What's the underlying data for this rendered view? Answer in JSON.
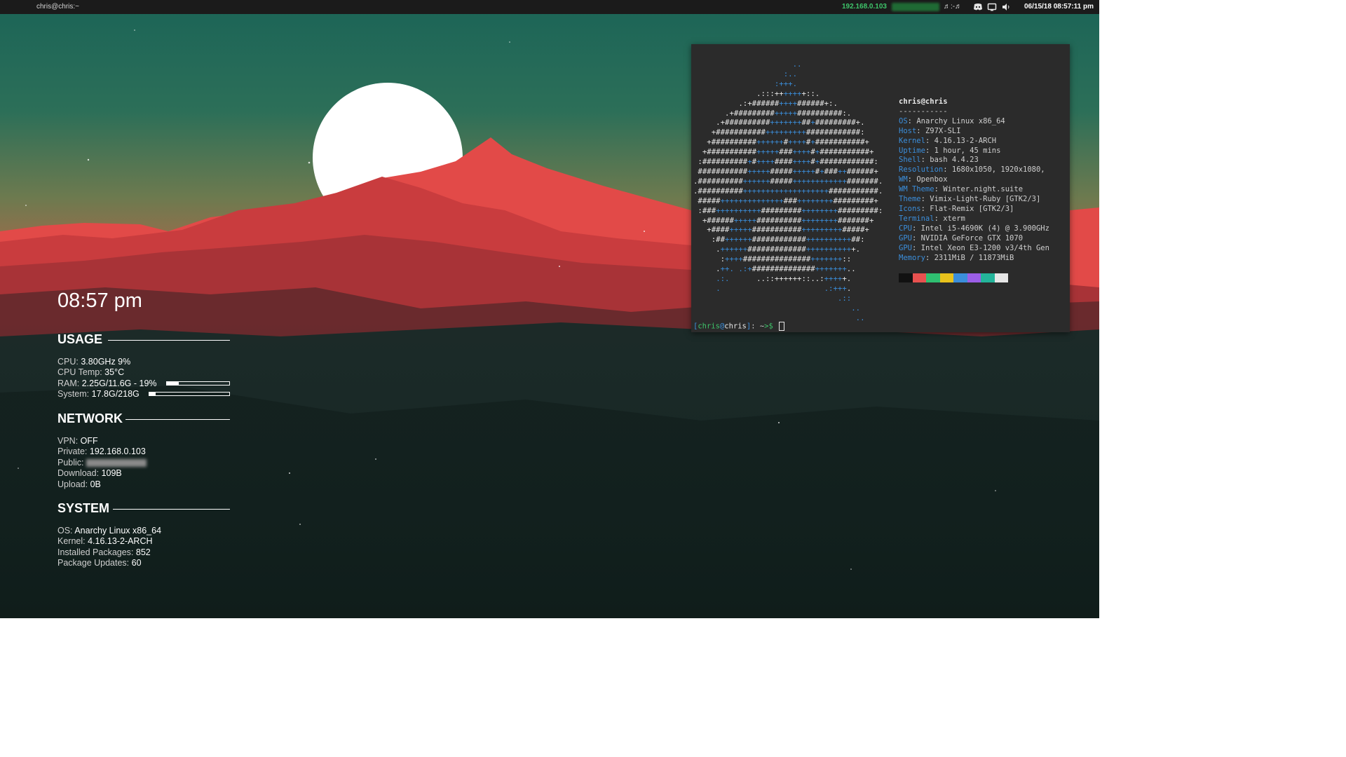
{
  "topbar": {
    "window_title": "chris@chris:~",
    "ip": "192.168.0.103",
    "music": "♬:-♬",
    "tray_icons": [
      "discord-icon",
      "display-icon",
      "volume-icon"
    ],
    "clock": "06/15/18 08:57:11 pm"
  },
  "conky": {
    "time": "08:57 pm",
    "usage": {
      "heading": "USAGE",
      "cpu_label": "CPU:",
      "cpu_value": "3.80GHz 9%",
      "temp_label": "CPU Temp:",
      "temp_value": "35°C",
      "ram_label": "RAM:",
      "ram_value": "2.25G/11.6G - 19%",
      "ram_fraction": 0.19,
      "system_label": "System:",
      "system_value": "17.8G/218G",
      "system_fraction": 0.08
    },
    "network": {
      "heading": "NETWORK",
      "vpn_label": "VPN:",
      "vpn_value": "OFF",
      "private_label": "Private:",
      "private_value": "192.168.0.103",
      "public_label": "Public:",
      "download_label": "Download:",
      "download_value": "109B",
      "upload_label": "Upload:",
      "upload_value": "0B"
    },
    "system": {
      "heading": "SYSTEM",
      "os_label": "OS:",
      "os_value": "Anarchy Linux x86_64",
      "kernel_label": "Kernel:",
      "kernel_value": "4.16.13-2-ARCH",
      "packages_label": "Installed Packages:",
      "packages_value": "852",
      "updates_label": "Package Updates:",
      "updates_value": "60"
    }
  },
  "terminal": {
    "user_host": "chris@chris",
    "separator": "-----------",
    "info": [
      {
        "key": "OS",
        "value": "Anarchy Linux x86_64"
      },
      {
        "key": "Host",
        "value": "Z97X-SLI"
      },
      {
        "key": "Kernel",
        "value": "4.16.13-2-ARCH"
      },
      {
        "key": "Uptime",
        "value": "1 hour, 45 mins"
      },
      {
        "key": "Shell",
        "value": "bash 4.4.23"
      },
      {
        "key": "Resolution",
        "value": "1680x1050, 1920x1080,"
      },
      {
        "key": "WM",
        "value": "Openbox"
      },
      {
        "key": "WM Theme",
        "value": "Winter.night.suite"
      },
      {
        "key": "Theme",
        "value": "Vimix-Light-Ruby [GTK2/3]"
      },
      {
        "key": "Icons",
        "value": "Flat-Remix [GTK2/3]"
      },
      {
        "key": "Terminal",
        "value": "xterm"
      },
      {
        "key": "CPU",
        "value": "Intel i5-4690K (4) @ 3.900GHz"
      },
      {
        "key": "GPU",
        "value": "NVIDIA GeForce GTX 1070"
      },
      {
        "key": "GPU",
        "value": "Intel Xeon E3-1200 v3/4th Gen"
      },
      {
        "key": "Memory",
        "value": "2311MiB / 11873MiB"
      }
    ],
    "swatch_colors": [
      "#111111",
      "#e8514f",
      "#2fbf71",
      "#e9c21c",
      "#3b8edb",
      "#9b5ee6",
      "#23b49a",
      "#e6e6e6"
    ],
    "prompt": {
      "open": "[",
      "user": "chris",
      "at": "@",
      "host": "chris",
      "close": "]",
      "path": ": ~",
      "symbol": ">$"
    }
  }
}
